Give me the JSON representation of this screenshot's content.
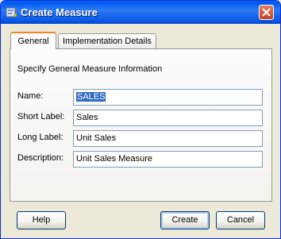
{
  "window": {
    "title": "Create Measure"
  },
  "tabs": [
    {
      "label": "General",
      "selected": true
    },
    {
      "label": "Implementation Details",
      "selected": false
    }
  ],
  "general": {
    "heading": "Specify General Measure Information",
    "fields": {
      "name": {
        "label": "Name:",
        "value": "SALES"
      },
      "short_label": {
        "label": "Short Label:",
        "value": "Sales"
      },
      "long_label": {
        "label": "Long Label:",
        "value": "Unit Sales"
      },
      "description": {
        "label": "Description:",
        "value": "Unit Sales Measure"
      }
    }
  },
  "buttons": {
    "help": "Help",
    "create": "Create",
    "cancel": "Cancel"
  }
}
